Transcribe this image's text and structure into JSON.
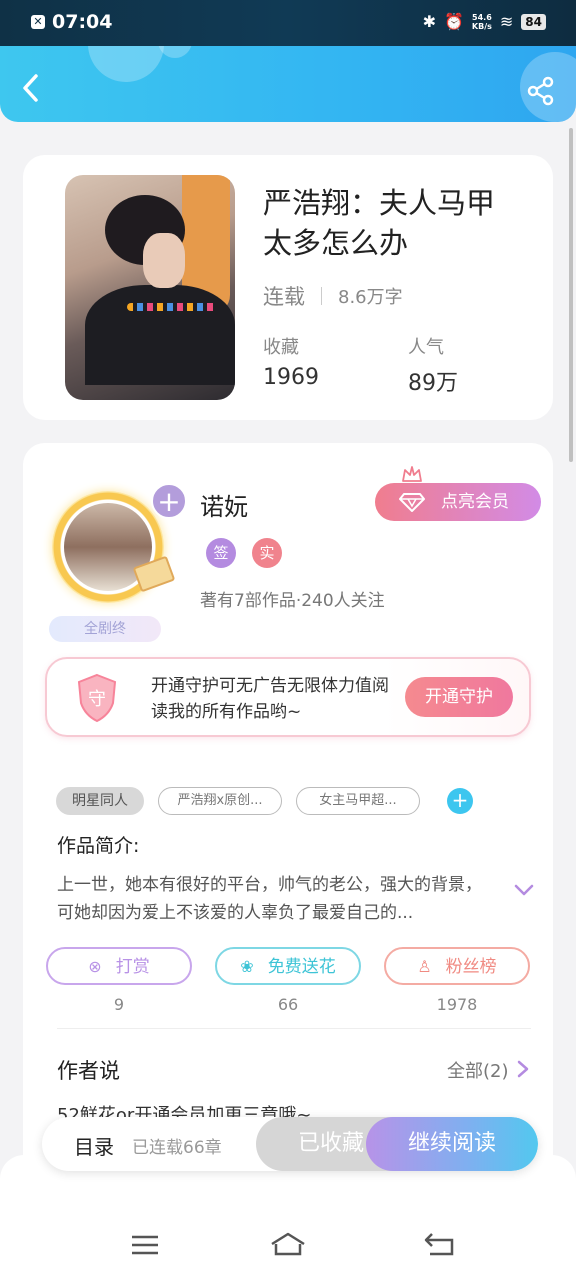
{
  "status_bar": {
    "time": "07:04",
    "speed_value": "54.6",
    "speed_unit": "KB/s",
    "battery": "84"
  },
  "header": {
    "back_icon": "chevron-left-icon",
    "share_icon": "share-icon",
    "accent": "#33b5f2"
  },
  "book": {
    "title": "严浩翔：夫人马甲太多怎么办",
    "status": "连载",
    "word_count": "8.6万字",
    "stats": [
      {
        "label": "收藏",
        "value": "1969"
      },
      {
        "label": "人气",
        "value": "89万"
      }
    ]
  },
  "author": {
    "name": "诺妧",
    "badges": [
      {
        "text": "签",
        "color": "#b48be0"
      },
      {
        "text": "实",
        "color": "#f0838d"
      }
    ],
    "stats_text": "著有7部作品·240人关注",
    "finished_badge": "全剧终",
    "vip_button": "点亮会员"
  },
  "guard": {
    "shield_text": "守",
    "text": "开通守护可无广告无限体力值阅读我的所有作品哟~",
    "button": "开通守护"
  },
  "tags": [
    "明星同人",
    "严浩翔x原创...",
    "女主马甲超..."
  ],
  "intro": {
    "title": "作品简介:",
    "text": "上一世，她本有很好的平台，帅气的老公，强大的背景，可她却因为爱上不该爱的人辜负了最爱自己的..."
  },
  "actions": [
    {
      "label": "打赏",
      "count": "9",
      "icon": "yen-icon",
      "color": "#b892e6"
    },
    {
      "label": "免费送花",
      "count": "66",
      "icon": "flower-icon",
      "color": "#3ec4d6"
    },
    {
      "label": "粉丝榜",
      "count": "1978",
      "icon": "user-rank-icon",
      "color": "#f08a82"
    }
  ],
  "author_say": {
    "title": "作者说",
    "all_link": "全部(2)",
    "text": "52鲜花or开通会员加更三章哦~"
  },
  "bottom_bar": {
    "catalog": "目录",
    "chapters": "已连载66章",
    "favorited": "已收藏",
    "continue": "继续阅读"
  }
}
